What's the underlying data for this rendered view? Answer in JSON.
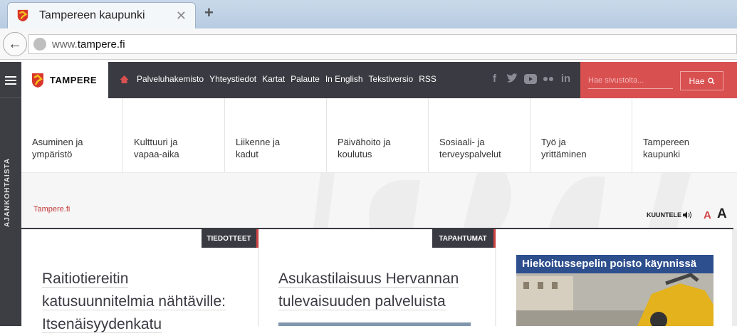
{
  "browser": {
    "tab_title": "Tampereen kaupunki",
    "close_glyph": "✕",
    "newtab_glyph": "+",
    "url_prefix": "www.",
    "url_domain": "tampere.fi",
    "back_glyph": "←"
  },
  "rail": {
    "label": "AJANKOHTAISTA"
  },
  "header": {
    "logo_text": "TAMPERE",
    "nav_links": [
      "Palveluhakemisto",
      "Yhteystiedot",
      "Kartat",
      "Palaute",
      "In English",
      "Tekstiversio",
      "RSS"
    ],
    "social_icons": [
      "facebook-icon",
      "twitter-icon",
      "youtube-icon",
      "flickr-icon",
      "linkedin-icon"
    ],
    "search_placeholder": "Hae sivustolta...",
    "search_button": "Hae"
  },
  "categories": [
    [
      "Asuminen ja",
      "ympäristö"
    ],
    [
      "Kulttuuri ja",
      "vapaa-aika"
    ],
    [
      "Liikenne ja",
      "kadut"
    ],
    [
      "Päivähoito ja",
      "koulutus"
    ],
    [
      "Sosiaali- ja",
      "terveyspalvelut"
    ],
    [
      "Työ ja",
      "yrittäminen"
    ],
    [
      "Tampereen",
      "kaupunki"
    ]
  ],
  "breadcrumb": "Tampere.fi",
  "tools": {
    "listen": "KUUNTELE",
    "font_small": "A",
    "font_large": "A"
  },
  "cards": [
    {
      "tag": "TIEDOTTEET",
      "headline": [
        "Raitiotiereitin",
        "katusuunnitelmia nähtäville:",
        "Itsenäisyydenkatu"
      ]
    },
    {
      "tag": "TAPAHTUMAT",
      "headline": [
        "Asukastilaisuus Hervannan",
        "tulevaisuuden palveluista"
      ]
    },
    {
      "banner_title": "Hiekoitussepelin poisto käynnissä"
    }
  ],
  "colors": {
    "accent_red": "#d95050",
    "dark": "#3a3a42"
  }
}
